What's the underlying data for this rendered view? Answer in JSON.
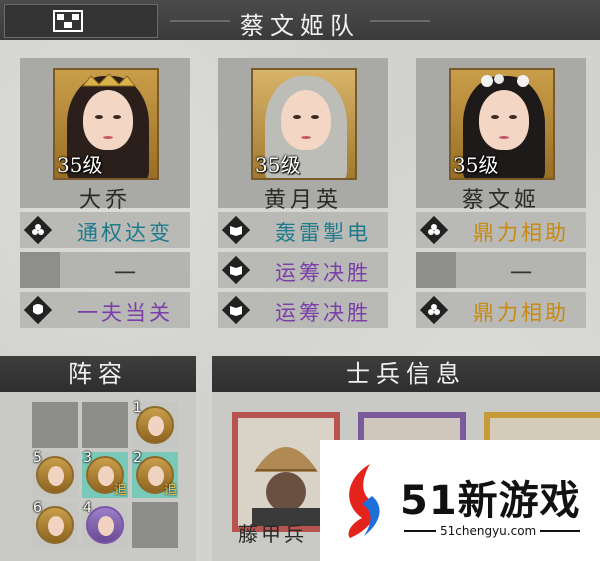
{
  "header": {
    "team_title": "蔡文姬队"
  },
  "heroes": [
    {
      "name": "大乔",
      "level": "35级",
      "skills": [
        {
          "label": "通权达变",
          "color": "teal",
          "icon": "flower-icon"
        },
        {
          "label": "一",
          "empty": true
        },
        {
          "label": "一夫当关",
          "color": "purple",
          "icon": "shield-swirl-icon"
        }
      ]
    },
    {
      "name": "黄月英",
      "level": "35级",
      "skills": [
        {
          "label": "轰雷掣电",
          "color": "teal",
          "icon": "book-icon"
        },
        {
          "label": "运筹决胜",
          "color": "purple",
          "icon": "book-icon"
        },
        {
          "label": "运筹决胜",
          "color": "purple",
          "icon": "book-icon"
        }
      ]
    },
    {
      "name": "蔡文姬",
      "level": "35级",
      "skills": [
        {
          "label": "鼎力相助",
          "color": "gold",
          "icon": "flower-icon"
        },
        {
          "label": "一",
          "empty": true
        },
        {
          "label": "鼎力相助",
          "color": "gold",
          "icon": "flower-icon"
        }
      ]
    }
  ],
  "lineup": {
    "title": "阵容",
    "units": [
      {
        "pos": "1",
        "tag": ""
      },
      {
        "pos": "5",
        "tag": ""
      },
      {
        "pos": "3",
        "tag": "追"
      },
      {
        "pos": "2",
        "tag": "追"
      },
      {
        "pos": "6",
        "tag": ""
      },
      {
        "pos": "4",
        "tag": ""
      }
    ]
  },
  "soldiers": {
    "title": "士兵信息",
    "first_name": "藤甲兵"
  },
  "watermark": {
    "brand": "51新游戏",
    "url": "51chengyu.com"
  },
  "colors": {
    "teal": "#1f7a8c",
    "purple": "#7a3fa8",
    "gold": "#c88a10"
  }
}
